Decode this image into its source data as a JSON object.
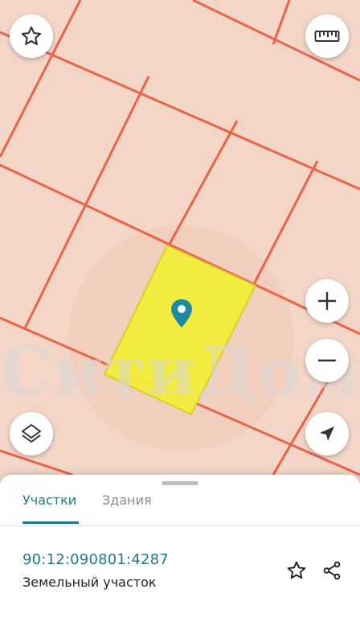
{
  "map": {
    "watermark": "СитиДом",
    "pin_icon": "location-pin-icon"
  },
  "controls": {
    "favorite_icon": "star-icon",
    "ruler_icon": "ruler-icon",
    "zoom_in_icon": "plus-icon",
    "zoom_out_icon": "minus-icon",
    "layers_icon": "layers-icon",
    "locate_icon": "navigation-arrow-icon"
  },
  "sheet": {
    "tabs": [
      {
        "label": "Участки",
        "active": true
      },
      {
        "label": "Здания",
        "active": false
      }
    ],
    "parcel": {
      "cadastral_number": "90:12:090801:4287",
      "type": "Земельный участок"
    },
    "actions": {
      "favorite_icon": "star-icon",
      "share_icon": "share-icon"
    }
  },
  "colors": {
    "map_background": "#f3d6c7",
    "parcel_borders": "#e8644a",
    "selected_parcel": "#f3ee3a",
    "accent": "#1f7a8c"
  }
}
